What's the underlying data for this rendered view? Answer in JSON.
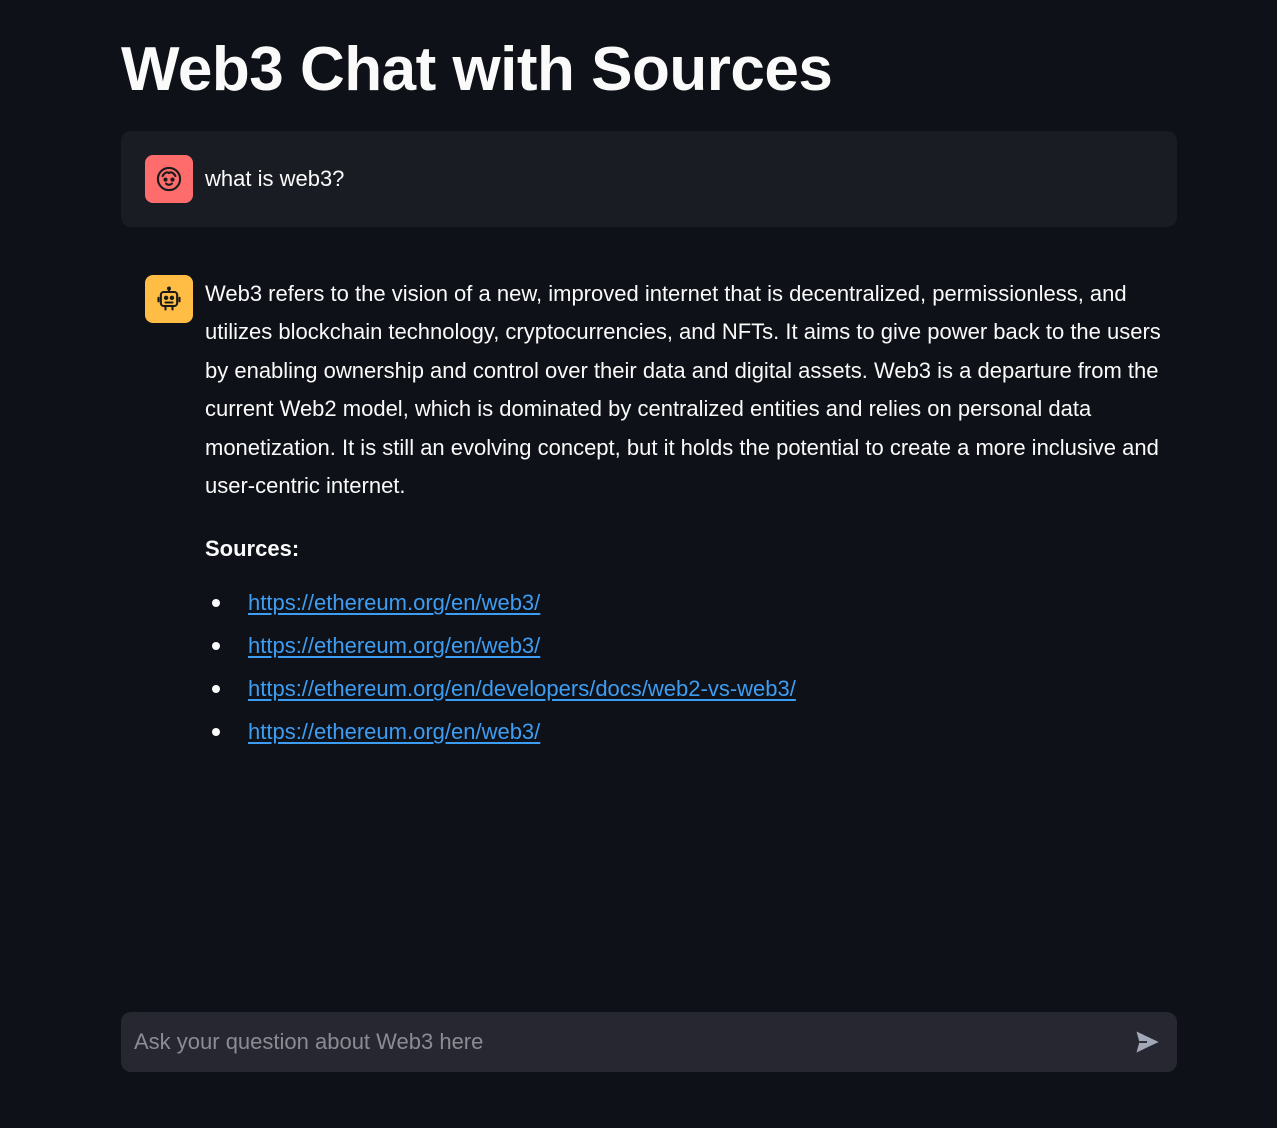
{
  "page": {
    "title": "Web3 Chat with Sources"
  },
  "messages": {
    "user": {
      "avatar_icon": "face-icon",
      "avatar_color": "#ff6c6c",
      "text": "what is web3?"
    },
    "assistant": {
      "avatar_icon": "robot-icon",
      "avatar_color": "#ffbd45",
      "answer": "Web3 refers to the vision of a new, improved internet that is decentralized, permissionless, and utilizes blockchain technology, cryptocurrencies, and NFTs. It aims to give power back to the users by enabling ownership and control over their data and digital assets. Web3 is a departure from the current Web2 model, which is dominated by centralized entities and relies on personal data monetization. It is still an evolving concept, but it holds the potential to create a more inclusive and user-centric internet.",
      "sources_heading": "Sources:",
      "sources": [
        "https://ethereum.org/en/web3/",
        "https://ethereum.org/en/web3/",
        "https://ethereum.org/en/developers/docs/web2-vs-web3/",
        "https://ethereum.org/en/web3/"
      ]
    }
  },
  "chat_input": {
    "placeholder": "Ask your question about Web3 here",
    "value": "",
    "send_icon": "send-icon"
  },
  "colors": {
    "background": "#0e1117",
    "user_message_bg": "#1a1c24",
    "input_bg": "#262730",
    "link": "#3d9df3"
  }
}
